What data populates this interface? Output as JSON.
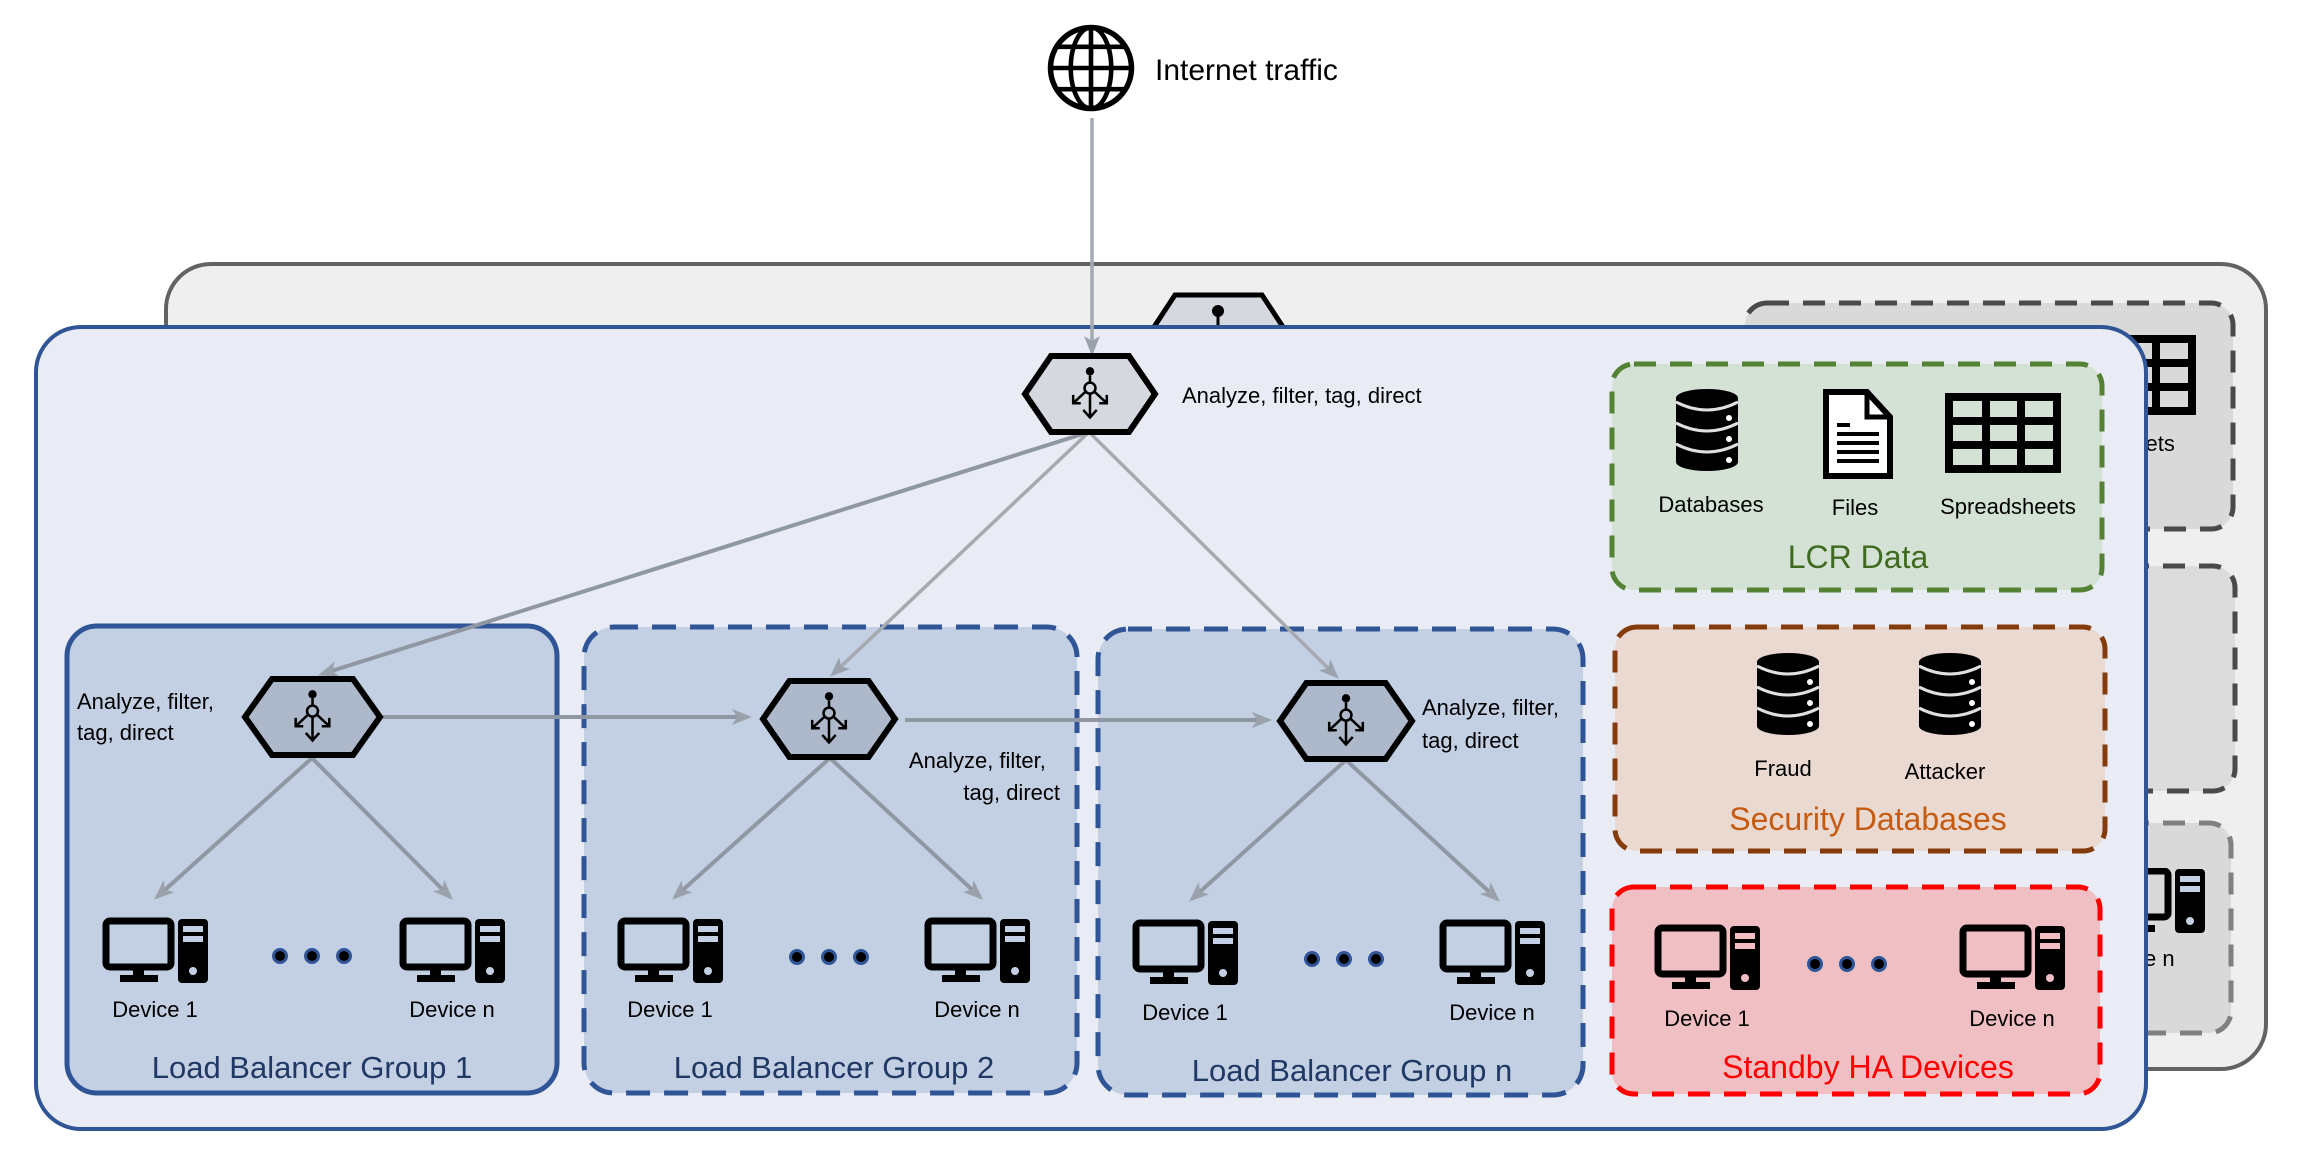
{
  "internet": {
    "label": "Internet traffic",
    "icon": "globe-icon"
  },
  "top_router": {
    "label": "Analyze, filter, tag, direct",
    "icon": "router-distribute-icon"
  },
  "groups": [
    {
      "title": "Load Balancer Group 1",
      "border": "solid",
      "router_label_lines": [
        "Analyze, filter,",
        "tag, direct"
      ],
      "devices": [
        "Device 1",
        "Device n"
      ]
    },
    {
      "title": "Load Balancer Group 2",
      "border": "dashed",
      "router_label_lines": [
        "Analyze, filter,",
        "tag, direct"
      ],
      "devices": [
        "Device 1",
        "Device n"
      ]
    },
    {
      "title": "Load Balancer Group n",
      "border": "dashed",
      "router_label_lines": [
        "Analyze, filter,",
        "tag, direct"
      ],
      "devices": [
        "Device 1",
        "Device n"
      ]
    }
  ],
  "lcr_data": {
    "title": "LCR Data",
    "items": [
      {
        "label": "Databases",
        "icon": "database-icon"
      },
      {
        "label": "Files",
        "icon": "file-icon"
      },
      {
        "label": "Spreadsheets",
        "icon": "spreadsheet-icon"
      }
    ]
  },
  "security_databases": {
    "title": "Security Databases",
    "items": [
      {
        "label": "Fraud",
        "icon": "database-icon"
      },
      {
        "label": "Attacker",
        "icon": "database-icon"
      }
    ]
  },
  "standby": {
    "title": "Standby HA Devices",
    "devices": [
      "Device 1",
      "Device n"
    ]
  },
  "back_layer": {
    "visible_fragments": [
      "sheets",
      "ce n"
    ]
  },
  "colors": {
    "front_panel_fill": "#e9ecf5",
    "front_panel_border": "#2f5597",
    "back_panel_fill": "#efefef",
    "back_panel_border": "#626262",
    "group_fill": "#c3cfe2",
    "group_border": "#2f5597",
    "group_title": "#1f3864",
    "lcr_fill": "#d3e2d4",
    "lcr_border": "#548235",
    "lcr_title": "#3f6a1f",
    "security_fill": "#ead9d0",
    "security_border": "#843c0c",
    "security_title": "#c55a11",
    "standby_fill": "#efbfc4",
    "standby_border": "#ff0000",
    "standby_title": "#ff0000",
    "arrow": "#a5a9b0",
    "router_fill": "#d5d8de",
    "router_fill_group": "#adb9ca"
  }
}
